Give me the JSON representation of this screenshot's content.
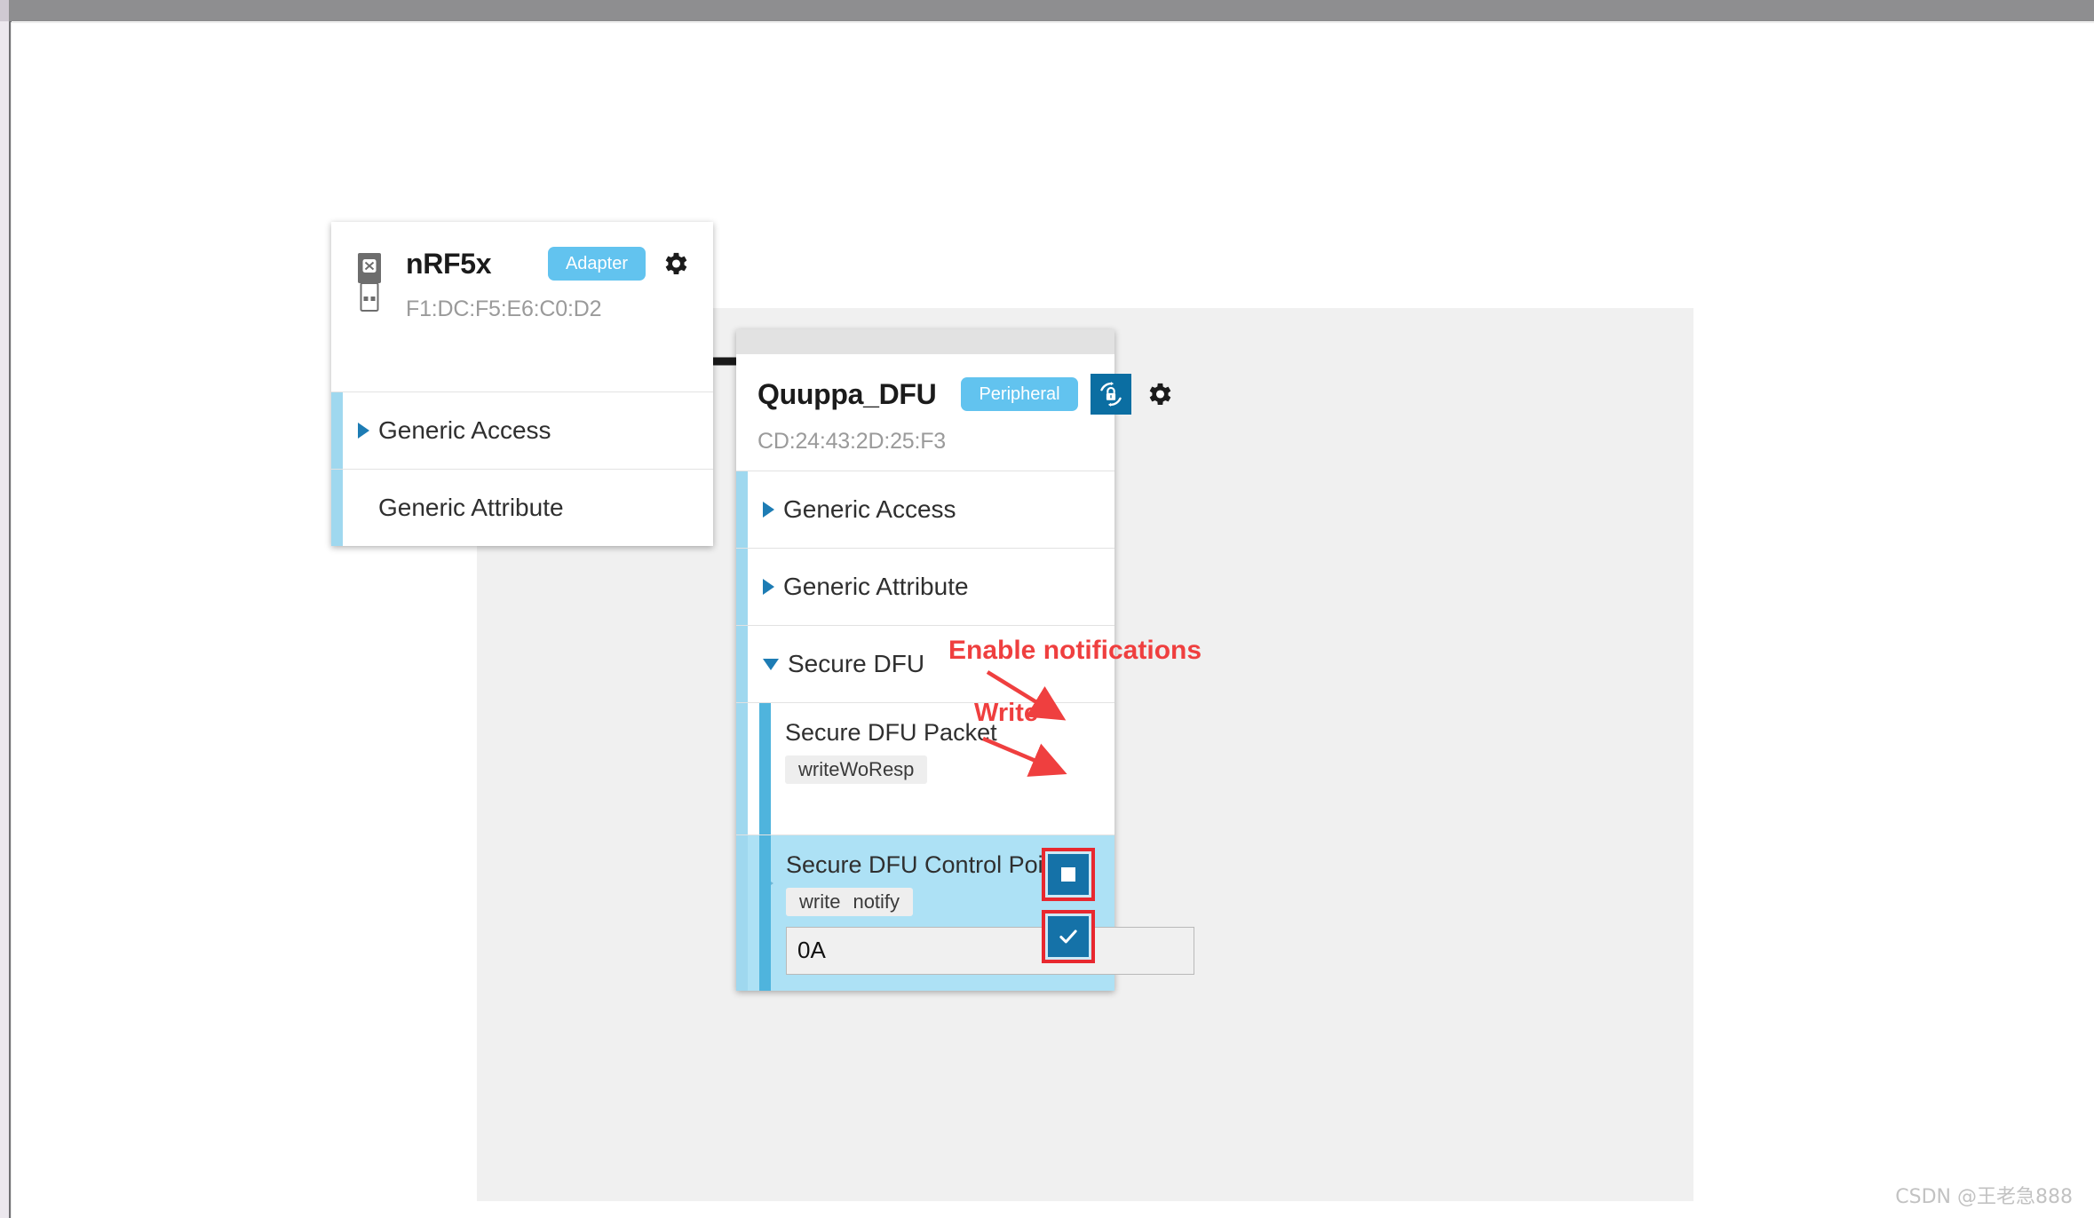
{
  "watermark": "CSDN @王老急888",
  "connection": {
    "lock_icon": "unlocked-padlock-icon",
    "lock_state": "unlocked"
  },
  "adapter_card": {
    "icon": "usb-dongle-icon",
    "name": "nRF5x",
    "role_badge": "Adapter",
    "address": "F1:DC:F5:E6:C0:D2",
    "settings_icon": "gear-icon",
    "services": [
      {
        "label": "Generic Access",
        "expanded": false,
        "has_toggle": true
      },
      {
        "label": "Generic Attribute",
        "expanded": false,
        "has_toggle": false
      }
    ]
  },
  "peripheral_card": {
    "name": "Quuppa_DFU",
    "role_badge": "Peripheral",
    "address": "CD:24:43:2D:25:F3",
    "dfu_icon": "dfu-secure-update-icon",
    "settings_icon": "gear-icon",
    "services": [
      {
        "label": "Generic Access",
        "expanded": false
      },
      {
        "label": "Generic Attribute",
        "expanded": false
      },
      {
        "label": "Secure DFU",
        "expanded": true
      }
    ],
    "characteristics": [
      {
        "name": "Secure DFU Packet",
        "properties": [
          "writeWoResp"
        ],
        "selected": false,
        "has_expand": false,
        "value": null
      },
      {
        "name": "Secure DFU Control Point",
        "properties": [
          "write",
          "notify"
        ],
        "selected": true,
        "has_expand": true,
        "value": "0A",
        "value_placeholder": ""
      }
    ],
    "actions": {
      "notify_toggle_icon": "stop-square-icon",
      "write_confirm_icon": "check-icon"
    }
  },
  "annotations": {
    "enable_notifications": "Enable notifications",
    "write": "Write",
    "color": "#ef3f3f"
  },
  "colors": {
    "accent_badge": "#62c3ef",
    "service_stripe": "#9fd8ef",
    "characteristic_stripe": "#4fb4dd",
    "selected_row": "#ade1f5",
    "action_button": "#1572a8",
    "highlight_border": "#e8282f",
    "canvas_bg": "#f0f0f0",
    "dfu_button": "#0b6ea2"
  }
}
